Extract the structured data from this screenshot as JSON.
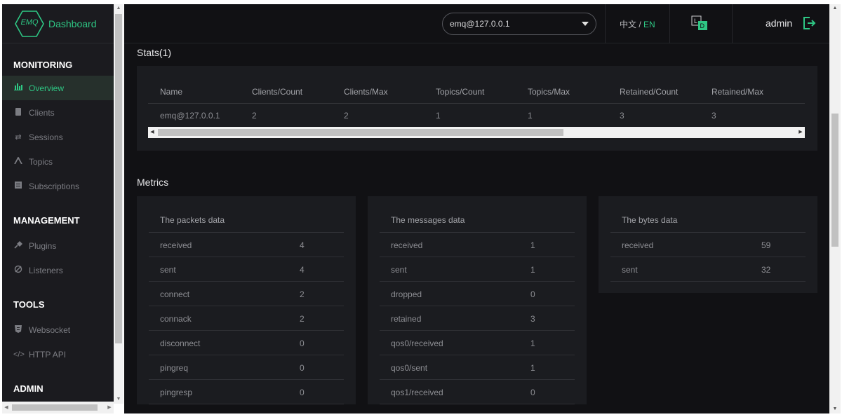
{
  "app": {
    "logo_text": "EMQ",
    "title": "Dashboard"
  },
  "sidebar": {
    "sections": [
      {
        "title": "MONITORING",
        "items": [
          {
            "label": "Overview",
            "icon": "bar-chart-icon",
            "active": true
          },
          {
            "label": "Clients",
            "icon": "device-icon"
          },
          {
            "label": "Sessions",
            "icon": "arrows-icon"
          },
          {
            "label": "Topics",
            "icon": "topic-icon"
          },
          {
            "label": "Subscriptions",
            "icon": "subscription-icon"
          }
        ]
      },
      {
        "title": "MANAGEMENT",
        "items": [
          {
            "label": "Plugins",
            "icon": "plug-icon"
          },
          {
            "label": "Listeners",
            "icon": "listener-icon"
          }
        ]
      },
      {
        "title": "TOOLS",
        "items": [
          {
            "label": "Websocket",
            "icon": "websocket-icon"
          },
          {
            "label": "HTTP API",
            "icon": "code-icon"
          }
        ]
      },
      {
        "title": "ADMIN",
        "items": []
      }
    ]
  },
  "header": {
    "node_select": "emq@127.0.0.1",
    "lang_zh": "中文",
    "lang_sep": " / ",
    "lang_en": "EN",
    "theme_light": "L",
    "theme_dark": "D",
    "user": "admin"
  },
  "stats": {
    "title": "Stats(1)",
    "columns": [
      "Name",
      "Clients/Count",
      "Clients/Max",
      "Topics/Count",
      "Topics/Max",
      "Retained/Count",
      "Retained/Max"
    ],
    "rows": [
      [
        "emq@127.0.0.1",
        "2",
        "2",
        "1",
        "1",
        "3",
        "3"
      ]
    ]
  },
  "metrics": {
    "title": "Metrics",
    "packets": {
      "title": "The packets data",
      "rows": [
        {
          "k": "received",
          "v": "4"
        },
        {
          "k": "sent",
          "v": "4"
        },
        {
          "k": "connect",
          "v": "2"
        },
        {
          "k": "connack",
          "v": "2"
        },
        {
          "k": "disconnect",
          "v": "0"
        },
        {
          "k": "pingreq",
          "v": "0"
        },
        {
          "k": "pingresp",
          "v": "0"
        }
      ]
    },
    "messages": {
      "title": "The messages data",
      "rows": [
        {
          "k": "received",
          "v": "1"
        },
        {
          "k": "sent",
          "v": "1"
        },
        {
          "k": "dropped",
          "v": "0"
        },
        {
          "k": "retained",
          "v": "3"
        },
        {
          "k": "qos0/received",
          "v": "1"
        },
        {
          "k": "qos0/sent",
          "v": "1"
        },
        {
          "k": "qos1/received",
          "v": "0"
        }
      ]
    },
    "bytes": {
      "title": "The bytes data",
      "rows": [
        {
          "k": "received",
          "v": "59"
        },
        {
          "k": "sent",
          "v": "32"
        }
      ]
    }
  },
  "colors": {
    "accent": "#2ec784",
    "bg": "#111114",
    "card": "#1b1c20",
    "sidebar": "#1b1b1f"
  }
}
